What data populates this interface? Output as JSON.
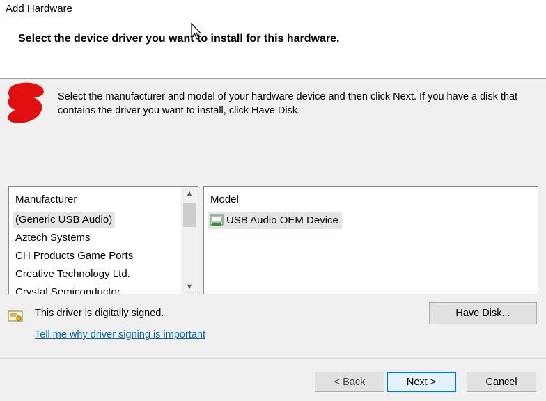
{
  "window": {
    "title": "Add Hardware"
  },
  "header": {
    "heading": "Select the device driver you want to install for this hardware."
  },
  "instructions": "Select the manufacturer and model of your hardware device and then click Next. If you have a disk that contains the driver you want to install, click Have Disk.",
  "manufacturer_list": {
    "header": "Manufacturer",
    "items": [
      {
        "label": "(Generic USB Audio)",
        "selected": true
      },
      {
        "label": "Aztech Systems",
        "selected": false
      },
      {
        "label": "CH Products Game Ports",
        "selected": false
      },
      {
        "label": "Creative Technology Ltd.",
        "selected": false
      },
      {
        "label": "Crystal Semiconductor",
        "selected": false
      }
    ]
  },
  "model_list": {
    "header": "Model",
    "items": [
      {
        "label": "USB Audio OEM Device",
        "selected": true,
        "icon": "device-driver-icon"
      }
    ]
  },
  "signing": {
    "status_text": "This driver is digitally signed.",
    "link_text": "Tell me why driver signing is important",
    "icon": "certificate-icon"
  },
  "buttons": {
    "have_disk": "Have Disk...",
    "back": "< Back",
    "next": "Next >",
    "cancel": "Cancel"
  },
  "colors": {
    "link": "#0066cc",
    "default_button_border": "#0078d7",
    "redaction": "#e01010"
  }
}
